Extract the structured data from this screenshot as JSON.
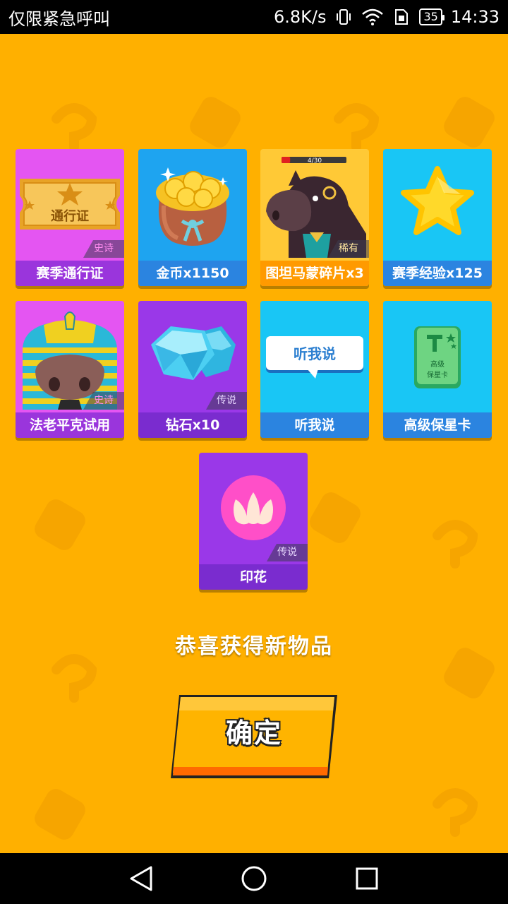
{
  "status_bar": {
    "carrier": "仅限紧急呼叫",
    "network_speed": "6.8K/s",
    "battery": "35",
    "time": "14:33",
    "icons": [
      "vibrate-icon",
      "wifi-icon",
      "sim-icon",
      "battery-icon"
    ]
  },
  "rewards": [
    {
      "name": "赛季通行证",
      "rarity": "史诗",
      "art_text": "通行证",
      "bg": "#e455f2",
      "label_bg": "#9a35dc"
    },
    {
      "name": "金币x1150",
      "rarity": "",
      "bg": "#1ea4f0",
      "label_bg": "#2b84e0"
    },
    {
      "name": "图坦马蒙碎片x3",
      "rarity": "稀有",
      "progress_text": "4/30",
      "progress": 0.133,
      "bg": "#ffc936",
      "label_bg": "#ff9a00"
    },
    {
      "name": "赛季经验x125",
      "rarity": "",
      "bg": "#19c6f5",
      "label_bg": "#2b84e0"
    },
    {
      "name": "法老平克试用",
      "rarity": "史诗",
      "bg": "#e455f2",
      "label_bg": "#9a35dc"
    },
    {
      "name": "钻石x10",
      "rarity": "传说",
      "bg": "#9a38e8",
      "label_bg": "#7a2ccf"
    },
    {
      "name": "听我说",
      "rarity": "",
      "art_text": "听我说",
      "bg": "#19c6f5",
      "label_bg": "#2b84e0"
    },
    {
      "name": "高级保星卡",
      "rarity": "",
      "art_text_line1": "高级",
      "art_text_line2": "保星卡",
      "bg": "#19c6f5",
      "label_bg": "#2b84e0"
    },
    {
      "name": "印花",
      "rarity": "传说",
      "bg": "#9a38e8",
      "label_bg": "#7a2ccf"
    }
  ],
  "message": "恭喜获得新物品",
  "confirm_label": "确定",
  "nav": {
    "back": "back-icon",
    "home": "home-icon",
    "recents": "recents-icon"
  }
}
